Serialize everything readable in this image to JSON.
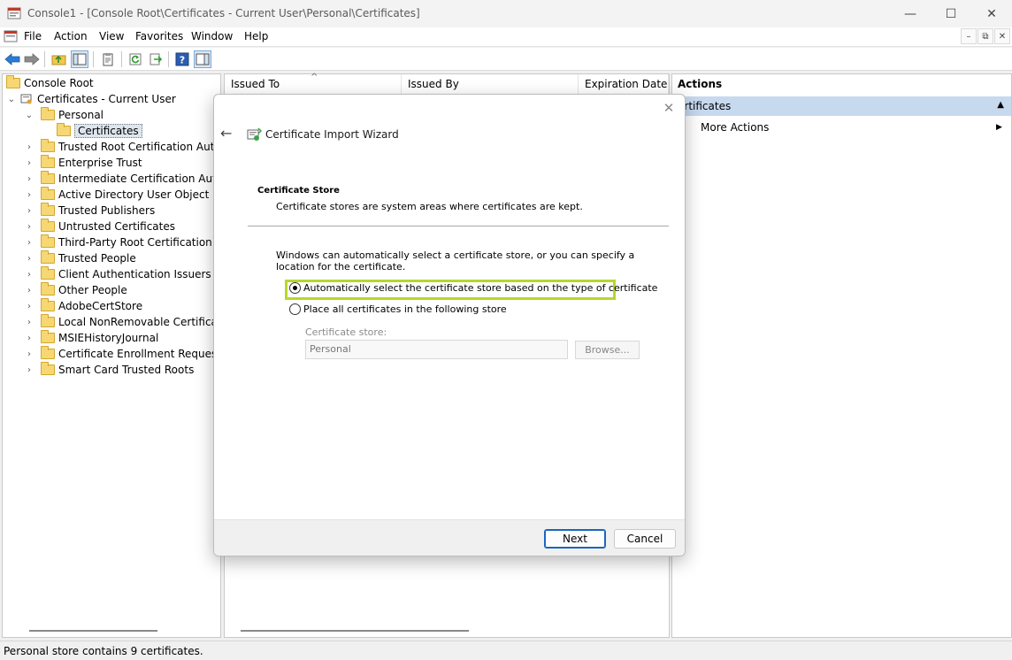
{
  "window": {
    "title": "Console1 - [Console Root\\Certificates - Current User\\Personal\\Certificates]",
    "minimize": "—",
    "maximize": "☐",
    "close": "✕"
  },
  "menubar": {
    "items": [
      "File",
      "Action",
      "View",
      "Favorites",
      "Window",
      "Help"
    ],
    "mdi_min": "–",
    "mdi_restore": "⧉",
    "mdi_close": "✕"
  },
  "toolbar": {
    "buttons": [
      "back-arrow-icon",
      "forward-arrow-icon",
      "up-folder-icon",
      "show-hide-tree-icon",
      "properties-icon",
      "refresh-icon",
      "export-list-icon",
      "help-icon",
      "show-hide-action-pane-icon"
    ]
  },
  "tree": {
    "root": "Console Root",
    "snapin": "Certificates - Current User",
    "personal": "Personal",
    "selected": "Certificates",
    "stores": [
      "Trusted Root Certification Authori",
      "Enterprise Trust",
      "Intermediate Certification Authori",
      "Active Directory User Object",
      "Trusted Publishers",
      "Untrusted Certificates",
      "Third-Party Root Certification Aut",
      "Trusted People",
      "Client Authentication Issuers",
      "Other People",
      "AdobeCertStore",
      "Local NonRemovable Certificates",
      "MSIEHistoryJournal",
      "Certificate Enrollment Requests",
      "Smart Card Trusted Roots"
    ]
  },
  "list": {
    "columns": [
      "Issued To",
      "Issued By",
      "Expiration Date"
    ],
    "sort_indicator": "^"
  },
  "actions": {
    "header": "Actions",
    "section": "ertificates",
    "section_toggle": "▲",
    "more_actions": "More Actions",
    "more_arrow": "▶"
  },
  "status": {
    "text": "Personal store contains 9 certificates."
  },
  "dialog": {
    "title": "Certificate Import Wizard",
    "close": "✕",
    "back": "←",
    "heading": "Certificate Store",
    "description": "Certificate stores are system areas where certificates are kept.",
    "intro": "Windows can automatically select a certificate store, or you can specify a location for the certificate.",
    "option_auto": "Automatically select the certificate store based on the type of certificate",
    "option_manual": "Place all certificates in the following store",
    "store_label": "Certificate store:",
    "store_value": "Personal",
    "browse": "Browse...",
    "next": "Next",
    "cancel": "Cancel",
    "highlight_color": "#b6d82b"
  }
}
